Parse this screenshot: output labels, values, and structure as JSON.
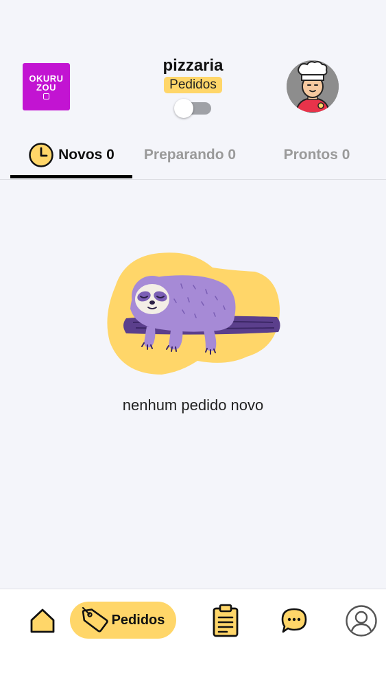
{
  "header": {
    "logo_line1": "OKURU",
    "logo_line2": "ZOU",
    "store_name": "pizzaria",
    "section_badge": "Pedidos",
    "toggle_on": false
  },
  "tabs": [
    {
      "label": "Novos 0",
      "active": true
    },
    {
      "label": "Preparando 0",
      "active": false
    },
    {
      "label": "Prontos 0",
      "active": false
    }
  ],
  "empty_state": {
    "message": "nenhum pedido novo",
    "illustration": "sleeping-sloth"
  },
  "bottom_nav": {
    "home_icon": "home-icon",
    "pedidos_label": "Pedidos",
    "orders_icon": "clipboard-icon",
    "chat_icon": "chat-icon",
    "profile_icon": "profile-icon"
  },
  "colors": {
    "accent_yellow": "#ffd669",
    "logo_magenta": "#c214d2",
    "background": "#f4f5fa",
    "sloth_purple": "#a68ad6"
  }
}
